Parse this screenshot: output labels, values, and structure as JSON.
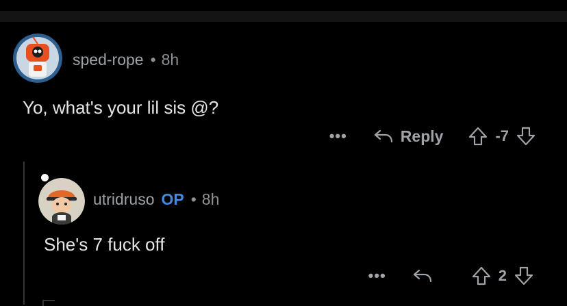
{
  "comments": [
    {
      "username": "sped-rope",
      "op_badge": "",
      "time": "8h",
      "body": "Yo, what's your lil sis @?",
      "more": "•••",
      "reply_label": "Reply",
      "score": "-7",
      "avatar_colors": {
        "ring": "#2f5f8f",
        "bg": "#c9d7e4",
        "robot": "#e8501f"
      }
    },
    {
      "username": "utridruso",
      "op_badge": "OP",
      "time": "8h",
      "body": "She's 7 fuck off",
      "more": "•••",
      "reply_label": "",
      "score": "2",
      "avatar_colors": {
        "bg": "#d8d2c4",
        "hat": "#e0682a",
        "skin": "#f3c9a5"
      }
    }
  ],
  "separator": "•",
  "colors": {
    "background": "#000000",
    "accent_op": "#3f8be8",
    "muted": "#8c9195"
  },
  "icons": [
    "more-icon",
    "reply-icon",
    "upvote-icon",
    "downvote-icon"
  ]
}
